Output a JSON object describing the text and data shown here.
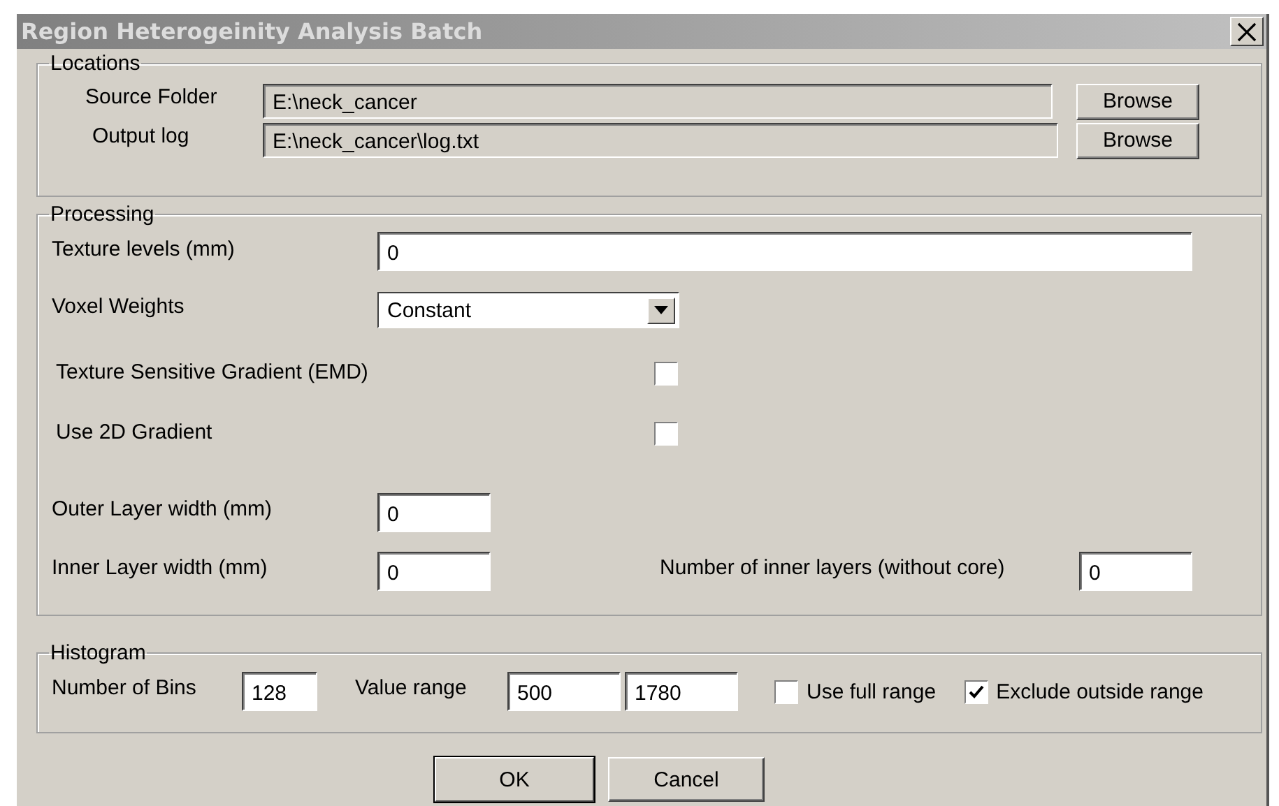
{
  "window": {
    "title": "Region Heterogeinity Analysis Batch"
  },
  "locations": {
    "title": "Locations",
    "rows": [
      {
        "label": "Source Folder",
        "value": "E:\\neck_cancer",
        "button": "Browse"
      },
      {
        "label": "Output log",
        "value": "E:\\neck_cancer\\log.txt",
        "button": "Browse"
      }
    ]
  },
  "processing": {
    "title": "Processing",
    "texture_levels": {
      "label": "Texture levels (mm)",
      "value": "0"
    },
    "voxel_weights": {
      "label": "Voxel Weights",
      "value": "Constant"
    },
    "options": [
      {
        "label": "Texture Sensitive Gradient (EMD)",
        "checked": false
      },
      {
        "label": "Use 2D Gradient",
        "checked": false
      }
    ],
    "outer_layer": {
      "label": "Outer Layer width (mm)",
      "value": "0"
    },
    "inner_layer": {
      "label": "Inner Layer width (mm)",
      "value": "0"
    },
    "inner_layer_count": {
      "label": "Number of inner layers (without core)",
      "value": "0"
    }
  },
  "histogram": {
    "title": "Histogram",
    "bins": {
      "label": "Number of Bins",
      "value": "128"
    },
    "value_range": {
      "label": "Value range",
      "min": "500",
      "max": "1780"
    },
    "options": [
      {
        "label": "Use full range",
        "checked": false
      },
      {
        "label": "Exclude outside range",
        "checked": true
      }
    ]
  },
  "buttons": [
    {
      "label": "OK",
      "default": true
    },
    {
      "label": "Cancel",
      "default": false
    }
  ]
}
